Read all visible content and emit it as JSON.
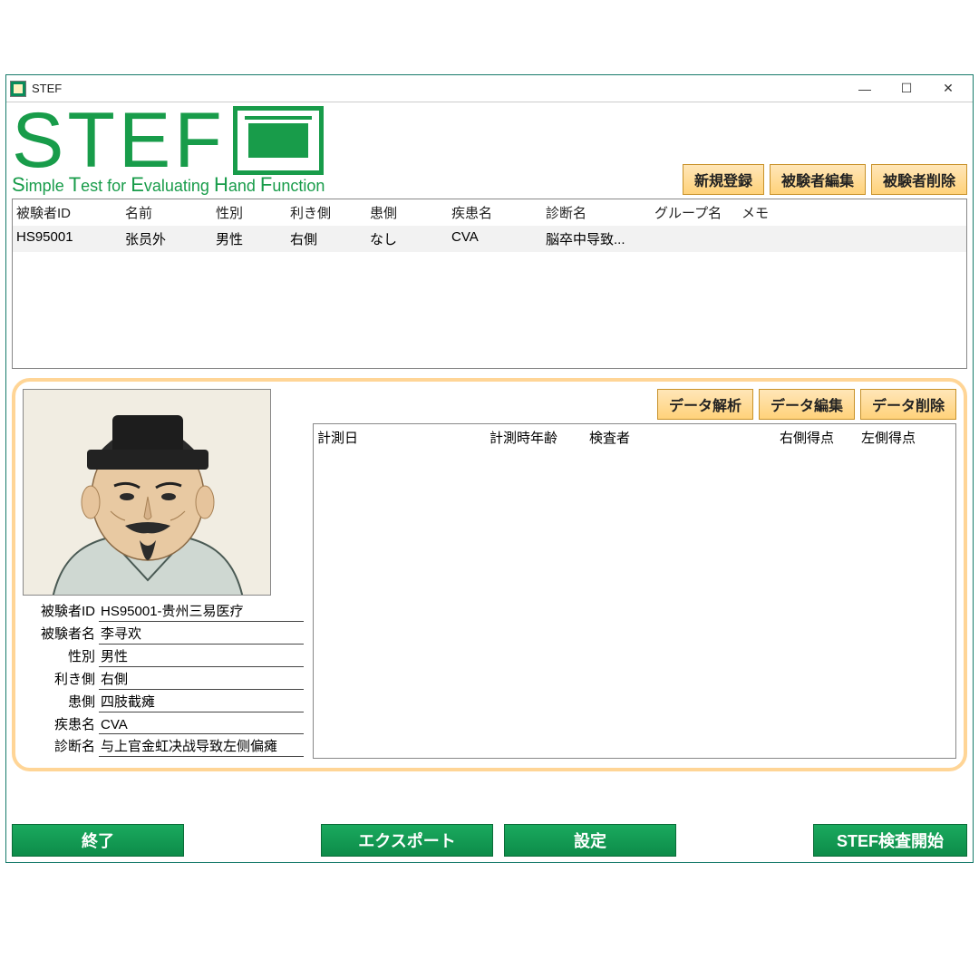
{
  "titlebar": {
    "title": "STEF"
  },
  "logo": {
    "tagline_parts": [
      "S",
      "imple ",
      "T",
      "est for ",
      "E",
      "valuating ",
      "H",
      "and ",
      "F",
      "unction"
    ]
  },
  "top_buttons": {
    "new": "新規登録",
    "edit": "被験者編集",
    "delete": "被験者削除"
  },
  "subject_table": {
    "headers": [
      "被験者ID",
      "名前",
      "性別",
      "利き側",
      "患側",
      "疾患名",
      "診断名",
      "グループ名",
      "メモ"
    ],
    "rows": [
      {
        "id": "HS95001",
        "name": "张员外",
        "sex": "男性",
        "dominant": "右側",
        "affected": "なし",
        "disease": "CVA",
        "diagnosis": "脳卒中导致...",
        "group": "",
        "memo": ""
      }
    ]
  },
  "detail": {
    "fields": {
      "id_label": "被験者ID",
      "id_value": "HS95001-贵州三易医疗",
      "name_label": "被験者名",
      "name_value": "李寻欢",
      "sex_label": "性別",
      "sex_value": "男性",
      "dominant_label": "利き側",
      "dominant_value": "右側",
      "affected_label": "患側",
      "affected_value": "四肢截瘫",
      "disease_label": "疾患名",
      "disease_value": "CVA",
      "diagnosis_label": "診断名",
      "diagnosis_value": "与上官金虹决战导致左侧偏瘫"
    },
    "buttons": {
      "analyze": "データ解析",
      "edit": "データ編集",
      "delete": "データ削除"
    },
    "measure_headers": [
      "計測日",
      "計測時年齢",
      "検査者",
      "右側得点",
      "左側得点"
    ]
  },
  "footer": {
    "exit": "終了",
    "export": "エクスポート",
    "settings": "設定",
    "start": "STEF検査開始"
  }
}
